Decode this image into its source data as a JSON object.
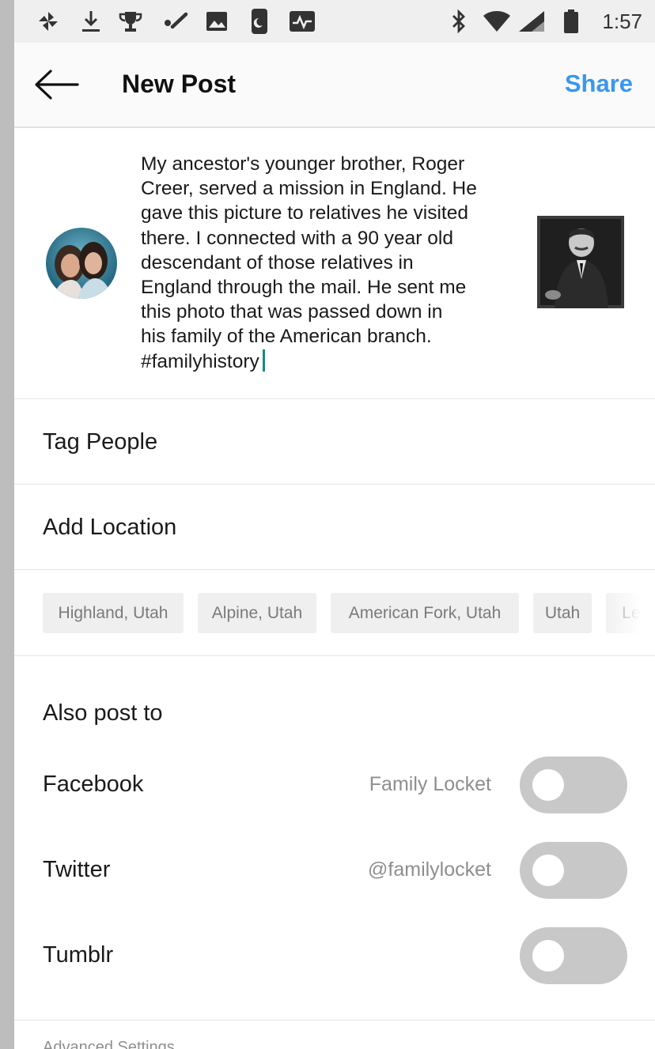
{
  "status_bar": {
    "time": "1:57",
    "left_icons": [
      "pinwheel-icon",
      "download-icon",
      "trophy-icon",
      "check-icon",
      "image-icon",
      "moon-phone-icon",
      "activity-icon"
    ],
    "right_icons": [
      "bluetooth-icon",
      "wifi-icon",
      "cell-signal-icon",
      "battery-icon"
    ]
  },
  "app_bar": {
    "title": "New Post",
    "share_label": "Share",
    "back_icon": "arrow-left-icon"
  },
  "caption": {
    "text": "My ancestor's younger brother, Roger\nCreer, served a mission in England. He\ngave this picture to relatives he visited\nthere. I connected with a 90 year old\ndescendant of those relatives in\nEngland through the mail. He sent me\nthis photo that was passed down in\nhis family of the American branch.\n#familyhistory"
  },
  "rows": {
    "tag_people": "Tag People",
    "add_location": "Add Location"
  },
  "location_suggestions": [
    "Highland, Utah",
    "Alpine, Utah",
    "American Fork, Utah",
    "Utah",
    "Lehi"
  ],
  "also_post_to": {
    "title": "Also post to",
    "targets": [
      {
        "label": "Facebook",
        "account": "Family Locket",
        "enabled": false
      },
      {
        "label": "Twitter",
        "account": "@familylocket",
        "enabled": false
      },
      {
        "label": "Tumblr",
        "account": "",
        "enabled": false
      }
    ]
  },
  "advanced_settings": "Advanced Settings",
  "colors": {
    "accent": "#3897f0",
    "cursor": "#1b8a7a",
    "toggle_off": "#c8c8c8"
  }
}
